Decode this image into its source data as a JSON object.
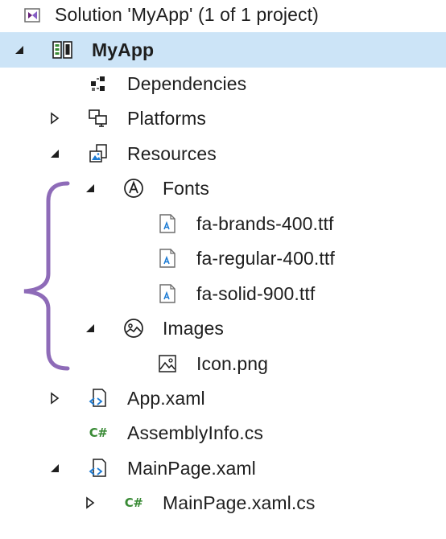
{
  "tree": {
    "solution": {
      "label": "Solution 'MyApp' (1 of 1 project)",
      "icon": "visual-studio-solution-icon"
    },
    "project": {
      "label": "MyApp",
      "icon": "project-icon"
    },
    "dependencies": {
      "label": "Dependencies",
      "icon": "dependencies-icon"
    },
    "platforms": {
      "label": "Platforms",
      "icon": "platforms-icon"
    },
    "resources": {
      "label": "Resources",
      "icon": "resources-icon"
    },
    "fonts": {
      "label": "Fonts",
      "icon": "font-folder-icon"
    },
    "font_files": [
      {
        "label": "fa-brands-400.ttf",
        "icon": "font-file-icon"
      },
      {
        "label": "fa-regular-400.ttf",
        "icon": "font-file-icon"
      },
      {
        "label": "fa-solid-900.ttf",
        "icon": "font-file-icon"
      }
    ],
    "images": {
      "label": "Images",
      "icon": "image-folder-icon"
    },
    "icon_png": {
      "label": "Icon.png",
      "icon": "image-file-icon"
    },
    "app_xaml": {
      "label": "App.xaml",
      "icon": "xaml-file-icon"
    },
    "assemblyinfo": {
      "label": "AssemblyInfo.cs",
      "icon": "csharp-file-icon",
      "badge": "C#"
    },
    "mainpage_xaml": {
      "label": "MainPage.xaml",
      "icon": "xaml-file-icon"
    },
    "mainpage_cs": {
      "label": "MainPage.xaml.cs",
      "icon": "csharp-file-icon",
      "badge": "C#"
    }
  },
  "colors": {
    "selection": "#cce4f7",
    "annotation_bracket": "#8e6bb8",
    "csharp": "#388a34",
    "xaml_blue": "#1c7bd4"
  }
}
